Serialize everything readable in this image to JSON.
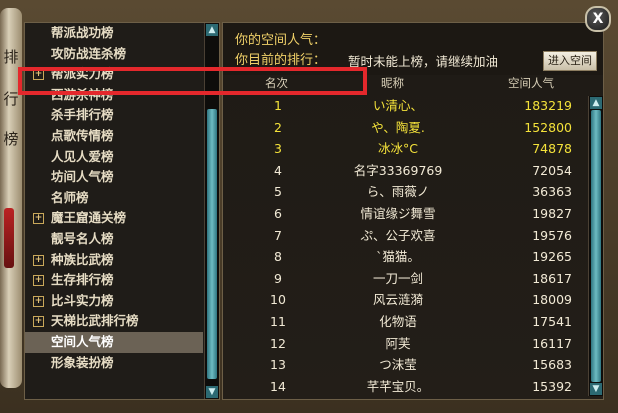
{
  "close_label": "X",
  "decor_glyphs": [
    "排",
    "行",
    "榜"
  ],
  "left_menu": [
    {
      "label": "帮派战功榜",
      "expand": false,
      "active": false
    },
    {
      "label": "攻防战连杀榜",
      "expand": false,
      "active": false
    },
    {
      "label": "帮派实力榜",
      "expand": true,
      "active": false
    },
    {
      "label": "西游杀神榜",
      "expand": false,
      "active": false
    },
    {
      "label": "杀手排行榜",
      "expand": false,
      "active": false
    },
    {
      "label": "点歌传情榜",
      "expand": false,
      "active": false
    },
    {
      "label": "人见人爱榜",
      "expand": false,
      "active": false
    },
    {
      "label": "坊间人气榜",
      "expand": false,
      "active": false
    },
    {
      "label": "名师榜",
      "expand": false,
      "active": false
    },
    {
      "label": "魔王窟通关榜",
      "expand": true,
      "active": false
    },
    {
      "label": "靓号名人榜",
      "expand": false,
      "active": false
    },
    {
      "label": "种族比武榜",
      "expand": true,
      "active": false
    },
    {
      "label": "生存排行榜",
      "expand": true,
      "active": false
    },
    {
      "label": "比斗实力榜",
      "expand": true,
      "active": false
    },
    {
      "label": "天梯比武排行榜",
      "expand": true,
      "active": false
    },
    {
      "label": "空间人气榜",
      "expand": false,
      "active": true
    },
    {
      "label": "形象装扮榜",
      "expand": false,
      "active": false
    }
  ],
  "info": {
    "line1": "你的空间人气：",
    "line2_label": "你目前的排行：",
    "line2_value": "暂时未能上榜，请继续加油",
    "enter_button": "进入空间"
  },
  "table": {
    "headers": [
      "名次",
      "昵称",
      "空间人气"
    ],
    "rows": [
      {
        "rank": "1",
        "name": "い清心、",
        "pop": "183219",
        "color": "#f4e23a"
      },
      {
        "rank": "2",
        "name": "や、陶夏.",
        "pop": "152800",
        "color": "#f4e23a"
      },
      {
        "rank": "3",
        "name": "冰冰°C",
        "pop": "74878",
        "color": "#f4e23a"
      },
      {
        "rank": "4",
        "name": "名字33369769",
        "pop": "72054",
        "color": "#f2ead6"
      },
      {
        "rank": "5",
        "name": "ら、雨薇ノ",
        "pop": "36363",
        "color": "#f2ead6"
      },
      {
        "rank": "6",
        "name": "情谊缘ジ舞雪",
        "pop": "19827",
        "color": "#f2ead6"
      },
      {
        "rank": "7",
        "name": "ぷ、公子欢喜",
        "pop": "19576",
        "color": "#f2ead6"
      },
      {
        "rank": "8",
        "name": "`猫猫。",
        "pop": "19265",
        "color": "#f2ead6"
      },
      {
        "rank": "9",
        "name": "一刀一剑",
        "pop": "18617",
        "color": "#f2ead6"
      },
      {
        "rank": "10",
        "name": "风云涟漪",
        "pop": "18009",
        "color": "#f2ead6"
      },
      {
        "rank": "11",
        "name": "化物语",
        "pop": "17541",
        "color": "#f2ead6"
      },
      {
        "rank": "12",
        "name": "阿芙",
        "pop": "16117",
        "color": "#f2ead6"
      },
      {
        "rank": "13",
        "name": "つ沫莹",
        "pop": "15683",
        "color": "#f2ead6"
      },
      {
        "rank": "14",
        "name": "芊芊宝贝。",
        "pop": "15392",
        "color": "#f2ead6"
      }
    ]
  },
  "colors": {
    "highlight_box": "#e4282c",
    "top_rank": "#f4e23a",
    "normal_text": "#f2ead6"
  }
}
